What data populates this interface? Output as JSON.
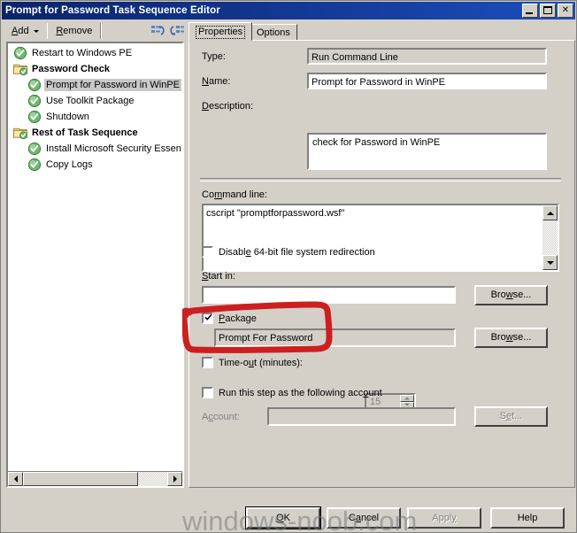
{
  "window": {
    "title": "Prompt for Password Task Sequence Editor",
    "titlebar_color": "#0a246a",
    "face_color": "#d4d0c8",
    "minimize_label": "Minimize",
    "maximize_label": "Maximize",
    "close_label": "Close",
    "close_glyph": "✕"
  },
  "toolbar": {
    "add_label": "Add",
    "remove_label": "Remove",
    "move_up_icon": "move-up-icon",
    "move_down_icon": "move-down-icon"
  },
  "tabs": [
    {
      "label": "Properties",
      "selected": true
    },
    {
      "label": "Options",
      "selected": false
    }
  ],
  "tree": {
    "items": [
      {
        "label": "Restart to Windows PE",
        "icon": "step-check-icon",
        "type": "step",
        "indent": 0,
        "selected": false
      },
      {
        "label": "Password Check",
        "icon": "folder-group-icon",
        "type": "group",
        "indent": 0,
        "selected": false
      },
      {
        "label": "Prompt for Password in WinPE",
        "icon": "step-check-icon",
        "type": "step",
        "indent": 1,
        "selected": true
      },
      {
        "label": "Use Toolkit Package",
        "icon": "step-check-icon",
        "type": "step",
        "indent": 1,
        "selected": false
      },
      {
        "label": "Shutdown",
        "icon": "step-check-icon",
        "type": "step",
        "indent": 1,
        "selected": false
      },
      {
        "label": "Rest of Task Sequence",
        "icon": "folder-group-icon",
        "type": "group",
        "indent": 0,
        "selected": false
      },
      {
        "label": "Install Microsoft Security Essen",
        "icon": "step-check-icon",
        "type": "step",
        "indent": 1,
        "selected": false
      },
      {
        "label": "Copy Logs",
        "icon": "step-check-icon",
        "type": "step",
        "indent": 1,
        "selected": false
      }
    ]
  },
  "properties": {
    "type_label": "Type:",
    "type_value": "Run Command Line",
    "name_label": "Name:",
    "name_value": "Prompt for Password in WinPE",
    "description_label": "Description:",
    "description_value": "check for Password in WinPE",
    "command_line_label": "Command line:",
    "command_line_value": "cscript \"promptforpassword.wsf\"",
    "disable_redirection_label": "Disable 64-bit file system redirection",
    "disable_redirection_checked": false,
    "start_in_label": "Start in:",
    "start_in_value": "",
    "start_in_browse_label": "Browse...",
    "package_label": "Package",
    "package_checked": true,
    "package_value": "Prompt For Password",
    "package_browse_label": "Browse...",
    "timeout_label": "Time-out (minutes):",
    "timeout_checked": false,
    "timeout_value": "15",
    "run_as_label": "Run this step as the following account",
    "run_as_checked": false,
    "account_label": "Account:",
    "account_value": "",
    "account_set_label": "Set..."
  },
  "footer": {
    "ok_label": "OK",
    "cancel_label": "Cancel",
    "apply_label": "Apply",
    "apply_enabled": false,
    "help_label": "Help"
  },
  "annotation": {
    "color": "#cc1f1f",
    "shape": "hand-drawn-rectangle-highlight",
    "target": "package-section"
  },
  "watermark": {
    "text": "windows-noob.com"
  }
}
